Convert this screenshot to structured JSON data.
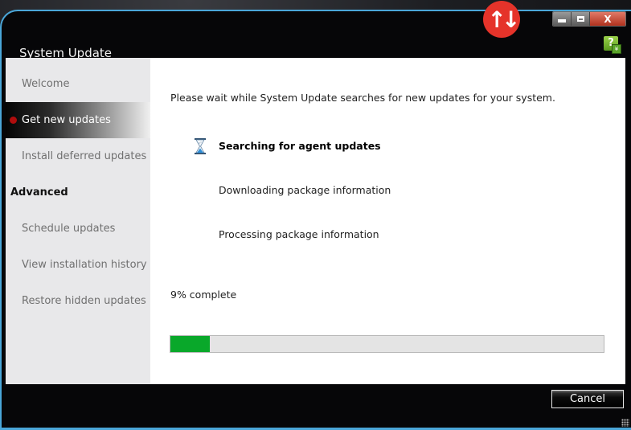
{
  "window": {
    "title": "System Update",
    "controls": {
      "minimize": "minimize",
      "maximize": "maximize",
      "close": "X"
    },
    "badge_icon": "up-down-arrows-icon",
    "help_icon": "help-icon",
    "help_label": "?"
  },
  "sidebar": {
    "items": [
      {
        "label": "Welcome",
        "active": false
      },
      {
        "label": "Get new updates",
        "active": true
      },
      {
        "label": "Install deferred updates",
        "active": false
      }
    ],
    "section_heading": "Advanced",
    "advanced_items": [
      {
        "label": "Schedule updates"
      },
      {
        "label": "View installation history"
      },
      {
        "label": "Restore hidden updates"
      }
    ]
  },
  "main": {
    "intro": "Please wait while System Update searches for new updates for your system.",
    "steps": [
      {
        "label": "Searching for agent updates",
        "status": "in-progress",
        "icon": "hourglass-icon"
      },
      {
        "label": "Downloading package information",
        "status": "pending"
      },
      {
        "label": "Processing package information",
        "status": "pending"
      }
    ],
    "progress_text": "9% complete",
    "progress_percent": 9,
    "progress_color": "#09a82a"
  },
  "footer": {
    "cancel_label": "Cancel"
  },
  "colors": {
    "accent_border": "#4aa6d8",
    "active_dot": "#b00d0d",
    "badge": "#e5332a"
  }
}
